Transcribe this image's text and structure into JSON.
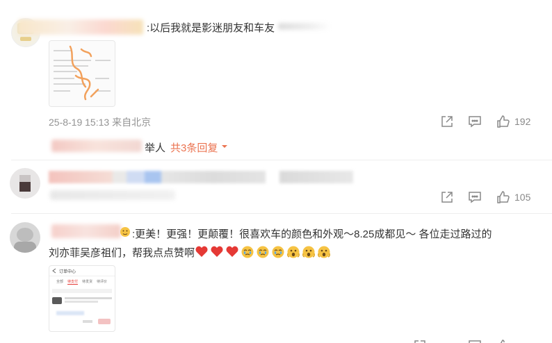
{
  "comments": [
    {
      "text": ":以后我就是影迷朋友和车友",
      "timestamp": "25-8-19 15:13",
      "location": "来自北京",
      "likes": "192",
      "reply_name_tail": "举人",
      "reply_link": "共3条回复"
    },
    {
      "likes": "105"
    },
    {
      "text_line1": ":更美！更强！更颠覆！很喜欢车的颜色和外观～8.25成都见～ 各位走过路过的",
      "text_line2": "刘亦菲吴彦祖们，帮我点点赞啊",
      "emojis": [
        "heart",
        "heart",
        "heart",
        "cry",
        "cry",
        "cry",
        "shock",
        "shock",
        "shock"
      ]
    }
  ],
  "thumb2_texts": {
    "header": "订单中心",
    "tabs": [
      "全部",
      "待支付",
      "待发货",
      "待评价"
    ]
  },
  "colors": {
    "accent": "#eb7350",
    "meta": "#939393",
    "heart": "#e53935",
    "emoji_yellow": "#f6c343"
  }
}
